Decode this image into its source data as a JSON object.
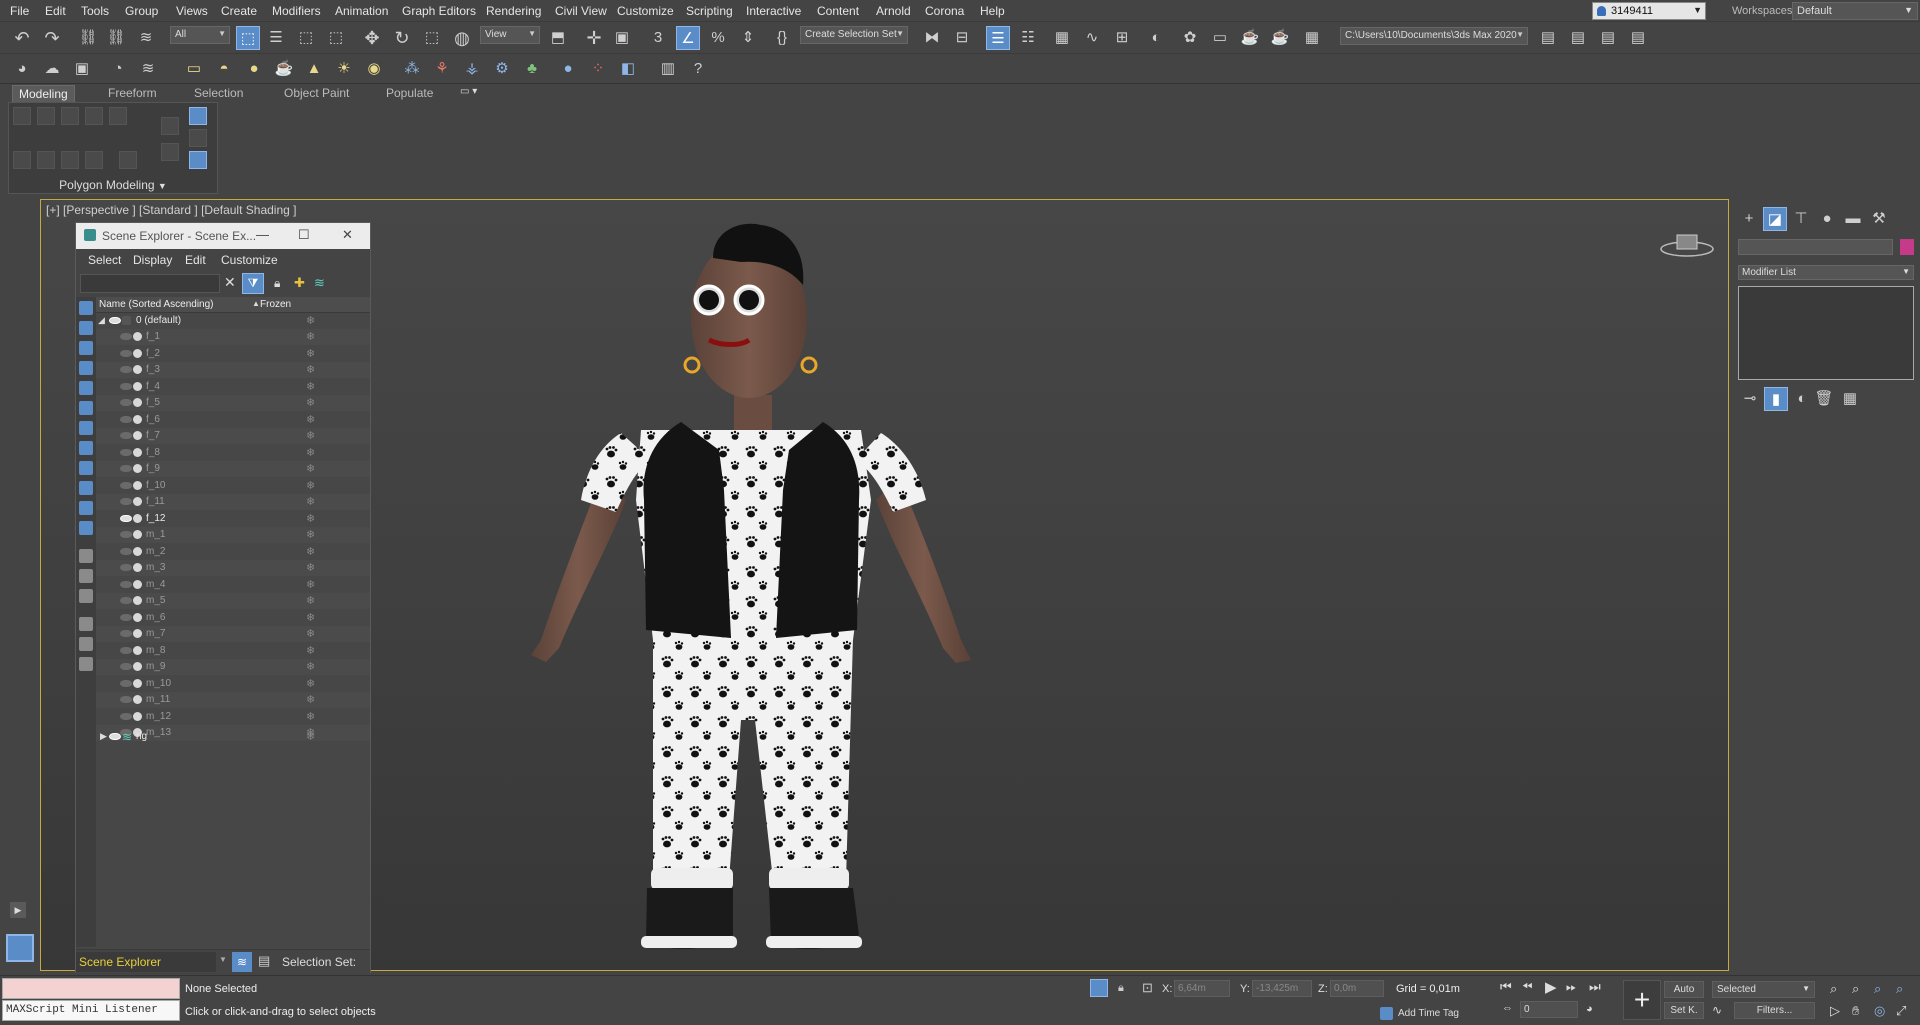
{
  "menubar": {
    "items": [
      "File",
      "Edit",
      "Tools",
      "Group",
      "Views",
      "Create",
      "Modifiers",
      "Animation",
      "Graph Editors",
      "Rendering",
      "Civil View",
      "Customize",
      "Scripting",
      "Interactive",
      "Content",
      "Arnold",
      "Corona",
      "Help"
    ],
    "user": "3149411",
    "workspaces_label": "Workspaces:",
    "workspace": "Default"
  },
  "toolbar": {
    "selection_filter": "All",
    "reference_coord": "View",
    "named_selection_set": "Create Selection Set",
    "project_path": "C:\\Users\\10\\Documents\\3ds Max 2020"
  },
  "ribbon": {
    "tabs": [
      "Modeling",
      "Freeform",
      "Selection",
      "Object Paint",
      "Populate"
    ],
    "active_tab": "Modeling",
    "panel_label": "Polygon Modeling"
  },
  "viewport": {
    "label": "[+] [Perspective ] [Standard ] [Default Shading ]"
  },
  "scene_explorer": {
    "title": "Scene Explorer - Scene Ex...",
    "menu": [
      "Select",
      "Display",
      "Edit",
      "Customize"
    ],
    "columns": {
      "name": "Name (Sorted Ascending)",
      "sort_arrow": "▲",
      "frozen": "Frozen"
    },
    "layer": "0 (default)",
    "items": [
      "f_1",
      "f_2",
      "f_3",
      "f_4",
      "f_5",
      "f_6",
      "f_7",
      "f_8",
      "f_9",
      "f_10",
      "f_11",
      "f_12",
      "m_1",
      "m_2",
      "m_3",
      "m_4",
      "m_5",
      "m_6",
      "m_7",
      "m_8",
      "m_9",
      "m_10",
      "m_11",
      "m_12",
      "m_13"
    ],
    "visible_item": "f_12",
    "rig_layer": "rig",
    "footer_selector": "Scene Explorer",
    "footer_label": "Selection Set:"
  },
  "command_panel": {
    "modifier_list": "Modifier List",
    "object_color": "#c63a8a"
  },
  "status": {
    "maxscript_label": "MAXScript Mini Listener",
    "selection": "None Selected",
    "prompt": "Click or click-and-drag to select objects",
    "x_label": "X:",
    "x_value": "6,64m",
    "y_label": "Y:",
    "y_value": "-13,425m",
    "z_label": "Z:",
    "z_value": "0,0m",
    "grid": "Grid = 0,01m",
    "add_time_tag": "Add Time Tag",
    "auto_key": "Auto",
    "set_key": "Set K.",
    "key_filter": "Selected",
    "filters": "Filters...",
    "frame": "0"
  },
  "colors": {
    "accent_blue": "#5a8cc7",
    "viewport_border": "#c8a840",
    "footer_text": "#e8d03a"
  }
}
